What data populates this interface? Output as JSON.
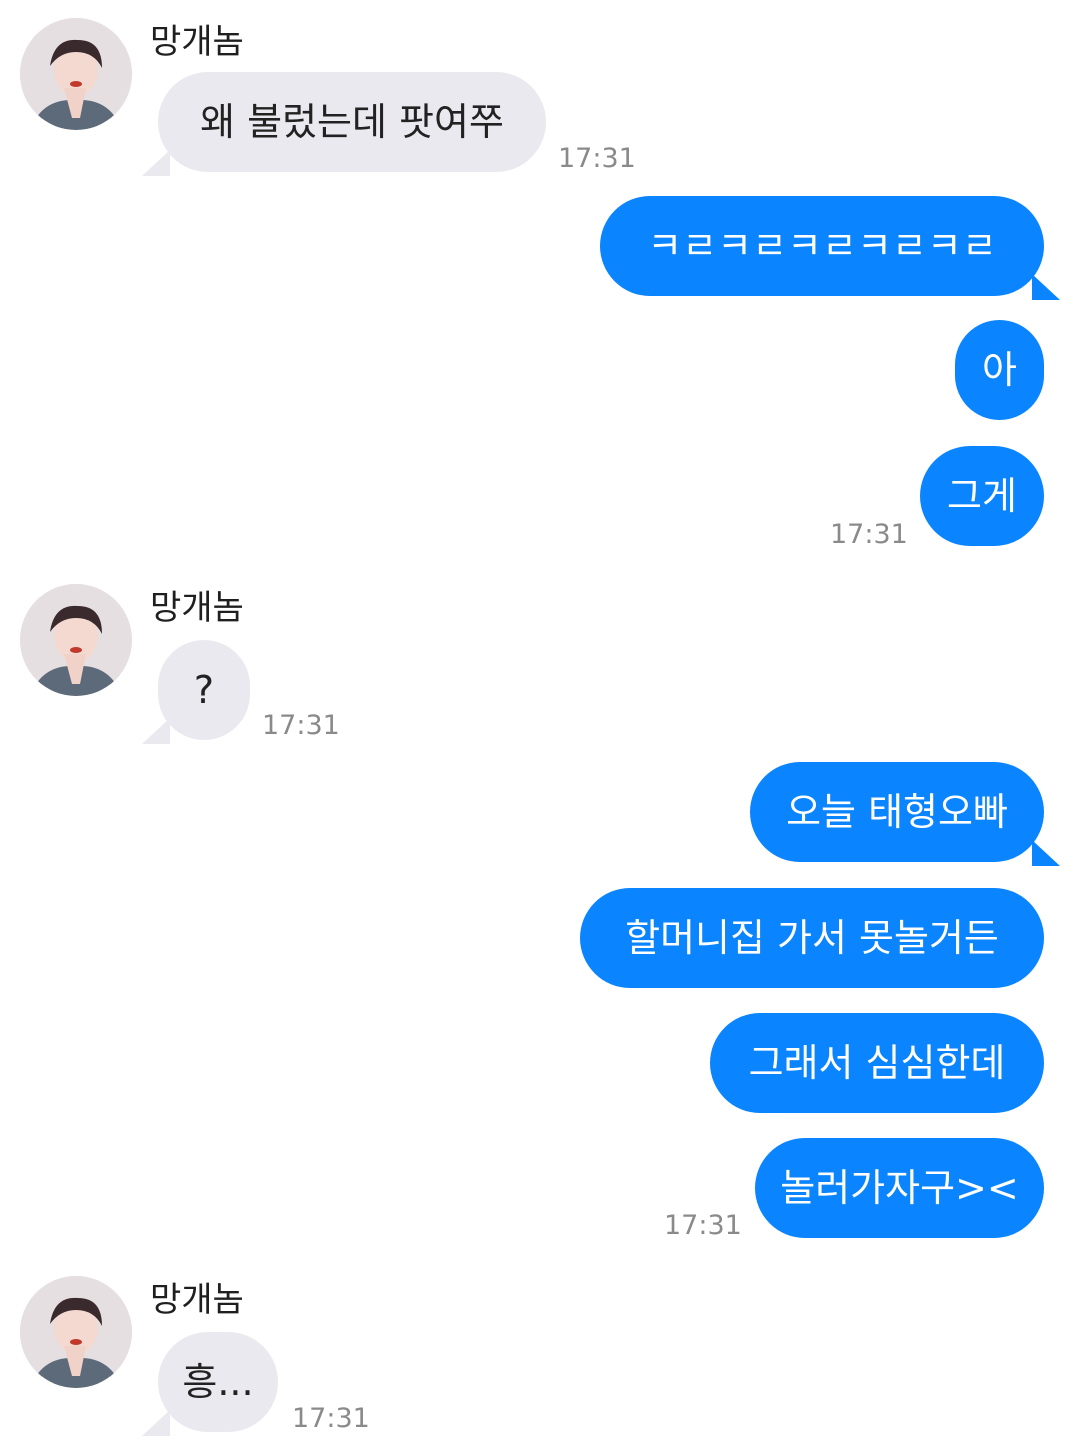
{
  "contact": {
    "name": "망개놈"
  },
  "messages": [
    {
      "text": "왜 불렀는데 팟여쭈",
      "time": "17:31"
    },
    {
      "text": "ㅋㄹㅋㄹㅋㄹㅋㄹㅋㄹ"
    },
    {
      "text": "아"
    },
    {
      "text": "그게",
      "time": "17:31"
    },
    {
      "text": "?",
      "time": "17:31"
    },
    {
      "text": "오늘 태형오빠"
    },
    {
      "text": "할머니집 가서 못놀거든"
    },
    {
      "text": "그래서 심심한데"
    },
    {
      "text": "놀러가자구><",
      "time": "17:31"
    },
    {
      "text": "흥...",
      "time": "17:31"
    }
  ],
  "colors": {
    "incoming_bubble": "#e9e9ef",
    "outgoing_bubble": "#0a84ff",
    "timestamp": "#8a8a8a"
  }
}
